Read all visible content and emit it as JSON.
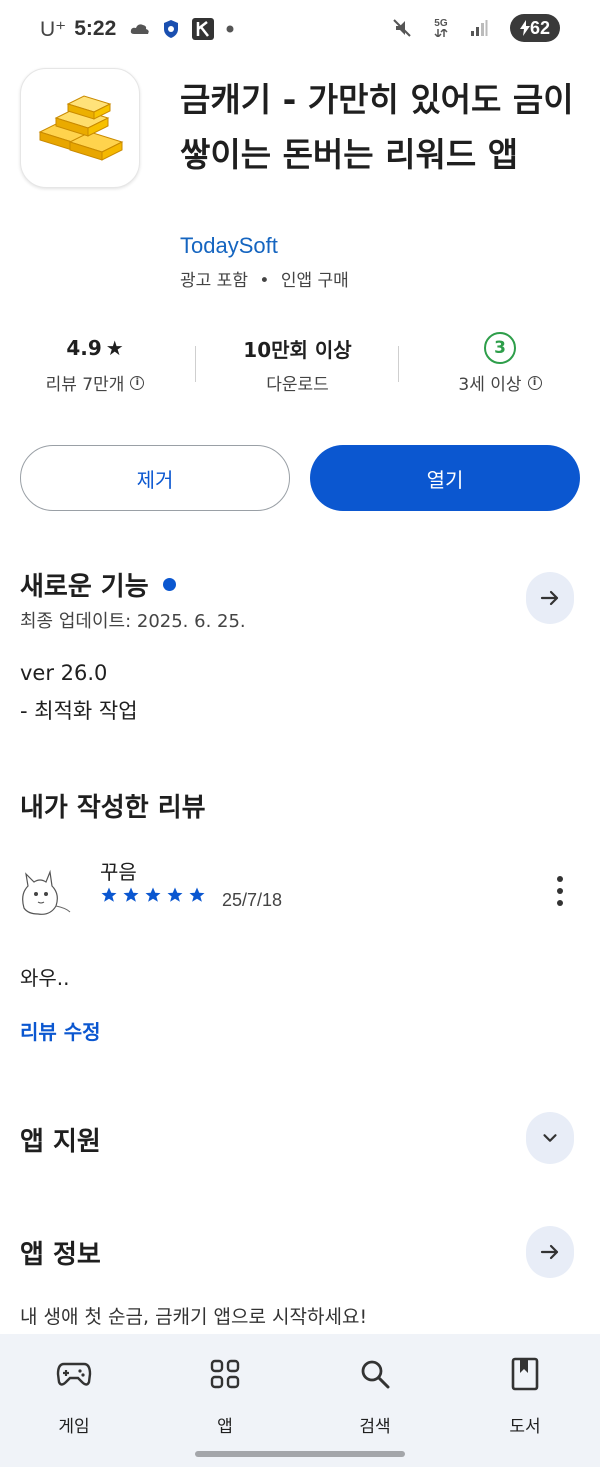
{
  "status_bar": {
    "carrier": "U⁺",
    "time": "5:22",
    "network": "5G",
    "battery": "62"
  },
  "app": {
    "title": "금캐기 - 가만히 있어도 금이 쌓이는 돈버는 리워드 앱",
    "developer": "TodaySoft",
    "meta_ads": "광고 포함",
    "meta_separator": "•",
    "meta_iap": "인앱 구매"
  },
  "stats": {
    "rating": "4.9",
    "rating_star": "★",
    "reviews_label": "리뷰 7만개",
    "downloads": "10만회 이상",
    "downloads_label": "다운로드",
    "age_value": "3",
    "age_label": "3세 이상"
  },
  "buttons": {
    "remove": "제거",
    "open": "열기"
  },
  "whats_new": {
    "title": "새로운 기능",
    "updated": "최종 업데이트: 2025. 6. 25.",
    "version": "ver 26.0",
    "note": "- 최적화 작업"
  },
  "my_review": {
    "title": "내가 작성한 리뷰",
    "reviewer": "꾸음",
    "stars": 5,
    "date": "25/7/18",
    "text": "와우..",
    "edit": "리뷰 수정"
  },
  "app_support": {
    "title": "앱 지원"
  },
  "app_info": {
    "title": "앱 정보",
    "description": "내 생애 첫 순금, 금캐기 앱으로 시작하세요!"
  },
  "bottom_nav": {
    "items": [
      {
        "label": "게임",
        "icon": "gamepad-icon"
      },
      {
        "label": "앱",
        "icon": "apps-grid-icon"
      },
      {
        "label": "검색",
        "icon": "search-icon"
      },
      {
        "label": "도서",
        "icon": "book-icon"
      }
    ]
  },
  "colors": {
    "accent": "#0b57d0",
    "link": "#1565c0",
    "age_green": "#2e9e4a",
    "nav_bg": "#f0f3f8"
  }
}
